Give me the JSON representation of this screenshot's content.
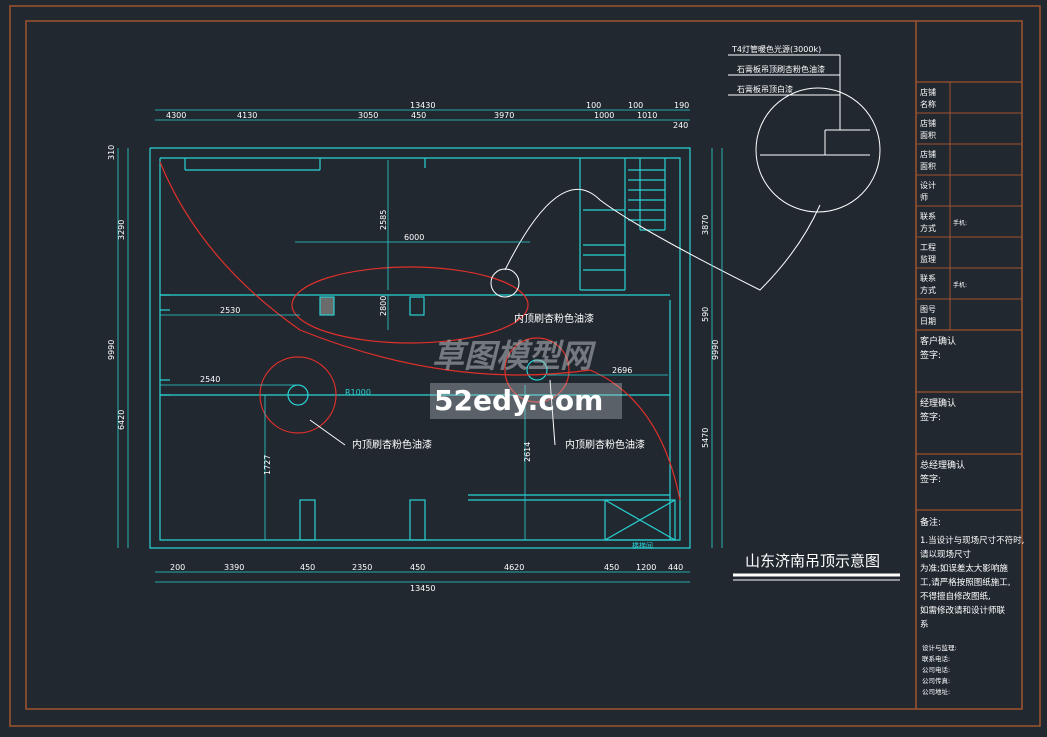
{
  "drawing": {
    "title": "山东济南吊顶示意图",
    "watermark": {
      "line1": "草图模型网",
      "line2": "52edy.com"
    },
    "notes": {
      "ceiling_paint_1": "内顶刷杏粉色油漆",
      "ceiling_paint_2": "内顶刷杏粉色油漆",
      "ceiling_paint_3": "内顶刷杏粉色油漆",
      "radius_label": "R1000"
    },
    "detail_callout": {
      "line1": "T4灯管暖色光源(3000k)",
      "line2": "石膏板吊顶刷杏粉色油漆",
      "line3": "石膏板吊顶白漆"
    },
    "dimensions": {
      "top_total": "13430",
      "top_segments": [
        "4130",
        "3050",
        "450",
        "3970",
        "1000",
        "1010",
        "240"
      ],
      "top_upper": [
        "100",
        "100",
        "190"
      ],
      "top_first": "4300",
      "bottom_total": "13450",
      "bottom_segments": [
        "200",
        "3390",
        "450",
        "2350",
        "450",
        "4620",
        "450",
        "1200",
        "440"
      ],
      "left_total": "9990",
      "left_segments": [
        "310",
        "3290",
        "6420"
      ],
      "right_total": "9990",
      "right_segments": [
        "3870",
        "590",
        "5470"
      ],
      "inner": [
        "2585",
        "6000",
        "2800",
        "2530",
        "2540",
        "2696",
        "1727",
        "2614"
      ],
      "stair_label": "楼梯间"
    }
  },
  "title_block": {
    "rows": [
      {
        "label": "店铺名称",
        "value": ""
      },
      {
        "label": "店铺面积",
        "value": ""
      },
      {
        "label": "店铺面积",
        "value": ""
      },
      {
        "label": "设计师",
        "value": ""
      },
      {
        "label": "联系方式",
        "value": "手机:"
      },
      {
        "label": "工程监理",
        "value": ""
      },
      {
        "label": "联系方式",
        "value": "手机:"
      },
      {
        "label": "图号日期",
        "value": ""
      }
    ],
    "client_confirm": "客户确认",
    "client_sign": "签字:",
    "manager_confirm": "经理确认",
    "manager_sign": "签字:",
    "gm_confirm": "总经理确认",
    "gm_sign": "签字:",
    "remarks_title": "备注:",
    "remarks": [
      "1.当设计与现场尺寸不符时,",
      "请以现场尺寸",
      "为准;如误差太大影响施",
      "工,请严格按照图纸施工,",
      "不得擅自修改图纸,",
      "如需修改请和设计师联",
      "系"
    ],
    "contact": [
      "设计与监理:",
      "联系电话:",
      "公司电话:",
      "公司传真:",
      "公司地址:"
    ]
  }
}
